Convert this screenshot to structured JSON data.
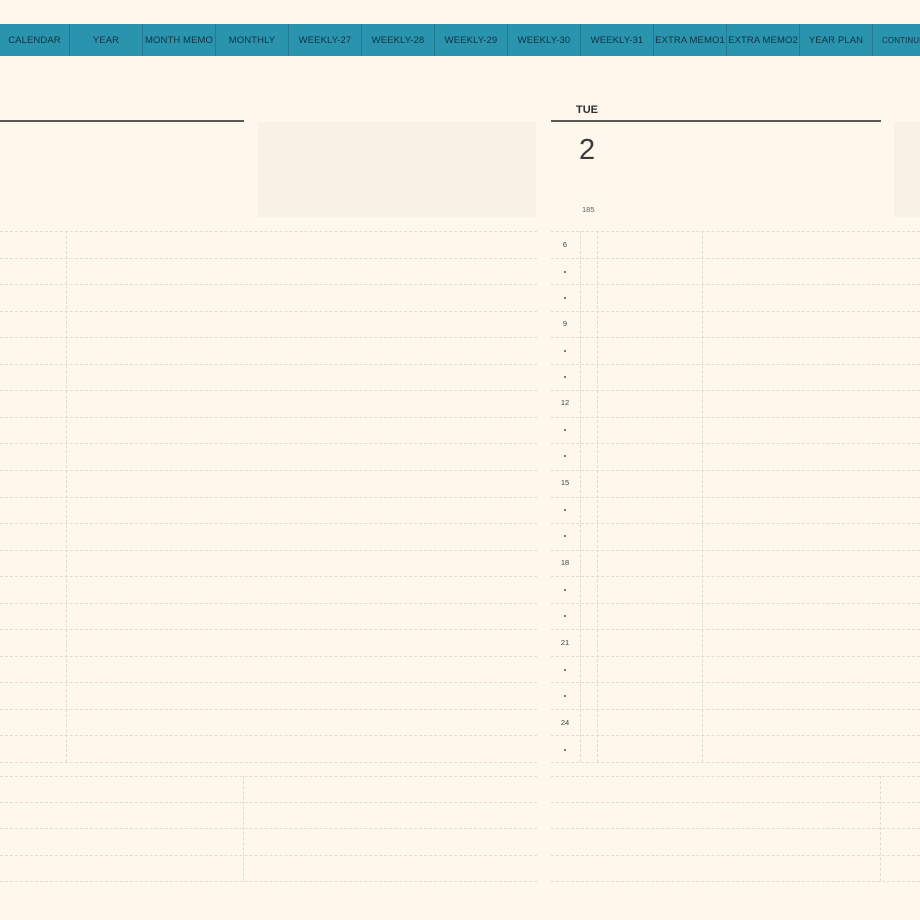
{
  "tabs": [
    "CALENDAR",
    "YEAR",
    "MONTH MEMO",
    "MONTHLY",
    "WEEKLY-27",
    "WEEKLY-28",
    "WEEKLY-29",
    "WEEKLY-30",
    "WEEKLY-31",
    "EXTRA MEMO1",
    "EXTRA MEMO2",
    "YEAR PLAN",
    "CONTINUE"
  ],
  "day": {
    "name": "TUE",
    "number": "2",
    "day_of_year": "185"
  },
  "time_labels": [
    "6",
    "9",
    "12",
    "15",
    "18",
    "21",
    "24"
  ],
  "colors": {
    "page": "#fdf7ec",
    "tab_bar": "#2a93ad",
    "tab_text": "#0f3340",
    "rule": "#5a5a57",
    "box": "#f8f1e6"
  }
}
